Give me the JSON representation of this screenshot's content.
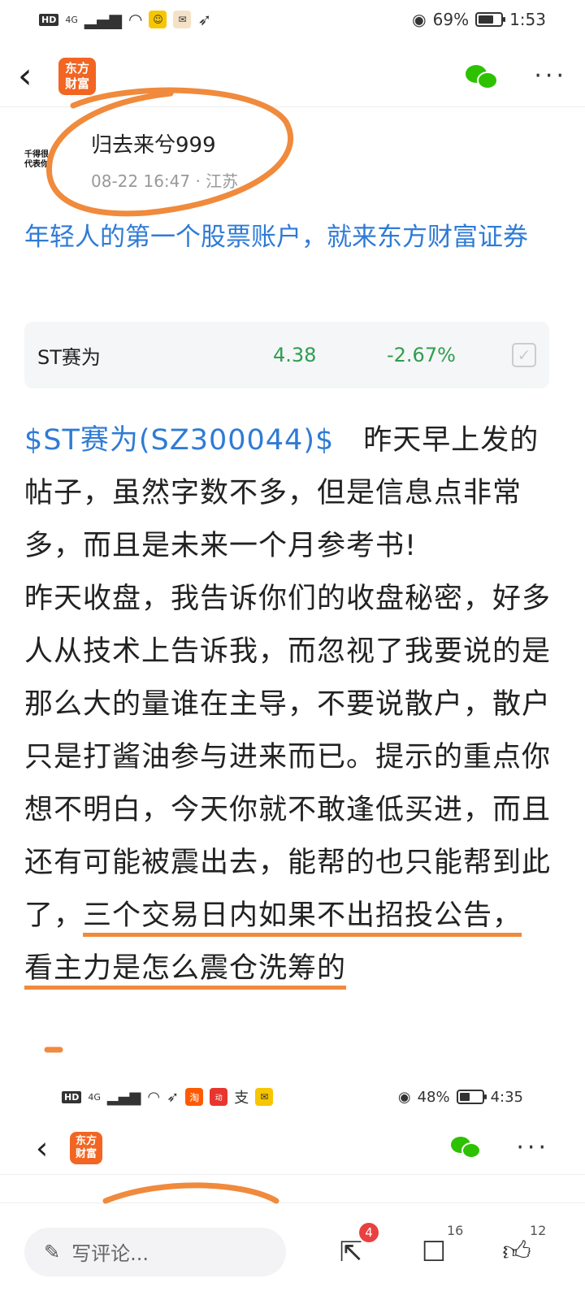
{
  "status_bar": {
    "hd": "HD",
    "signal": "4G",
    "battery": "69%",
    "battery_level": 0.69,
    "time": "1:53"
  },
  "nav": {
    "logo_line1": "东方",
    "logo_line2": "财富"
  },
  "author": {
    "avatar_line1": "千得很",
    "avatar_line2": "代表你",
    "name": "归去来兮999",
    "meta": "08-22 16:47 · 江苏"
  },
  "promo": "年轻人的第一个股票账户，就来东方财富证券",
  "stock": {
    "name": "ST赛为",
    "price": "4.38",
    "change": "-2.67%"
  },
  "article": {
    "stock_tag": "$ST赛为(SZ300044)$",
    "p1": "　昨天早上发的帖子，虽然字数不多，但是信息点非常多，而且是未来一个月参考书!",
    "p2_pre": "昨天收盘，我告诉你们的收盘秘密，好多人从技术上告诉我，而忽视了我要说的是那么大的量谁在主导，不要说散户，散户只是打酱油参与进来而已。提示的重点你想不明白，今天你就不敢逢低买进，而且还有可能被震出去，能帮的也只能帮到此了，",
    "p2_highlight": "三个交易日内如果不出招投公告，看主力是怎么震仓洗筹的"
  },
  "status_bar2": {
    "hd": "HD",
    "signal": "4G",
    "battery": "48%",
    "battery_level": 0.48,
    "time": "4:35"
  },
  "nav2": {
    "logo_line1": "东方",
    "logo_line2": "财富"
  },
  "bottom": {
    "comment_placeholder": "写评论...",
    "share_badge": "4",
    "comment_count": "16",
    "like_count": "12"
  },
  "colors": {
    "link": "#2f7bd6",
    "stock_down": "#2e9e4e",
    "brand": "#f26522",
    "annotation": "#f08a3c"
  }
}
